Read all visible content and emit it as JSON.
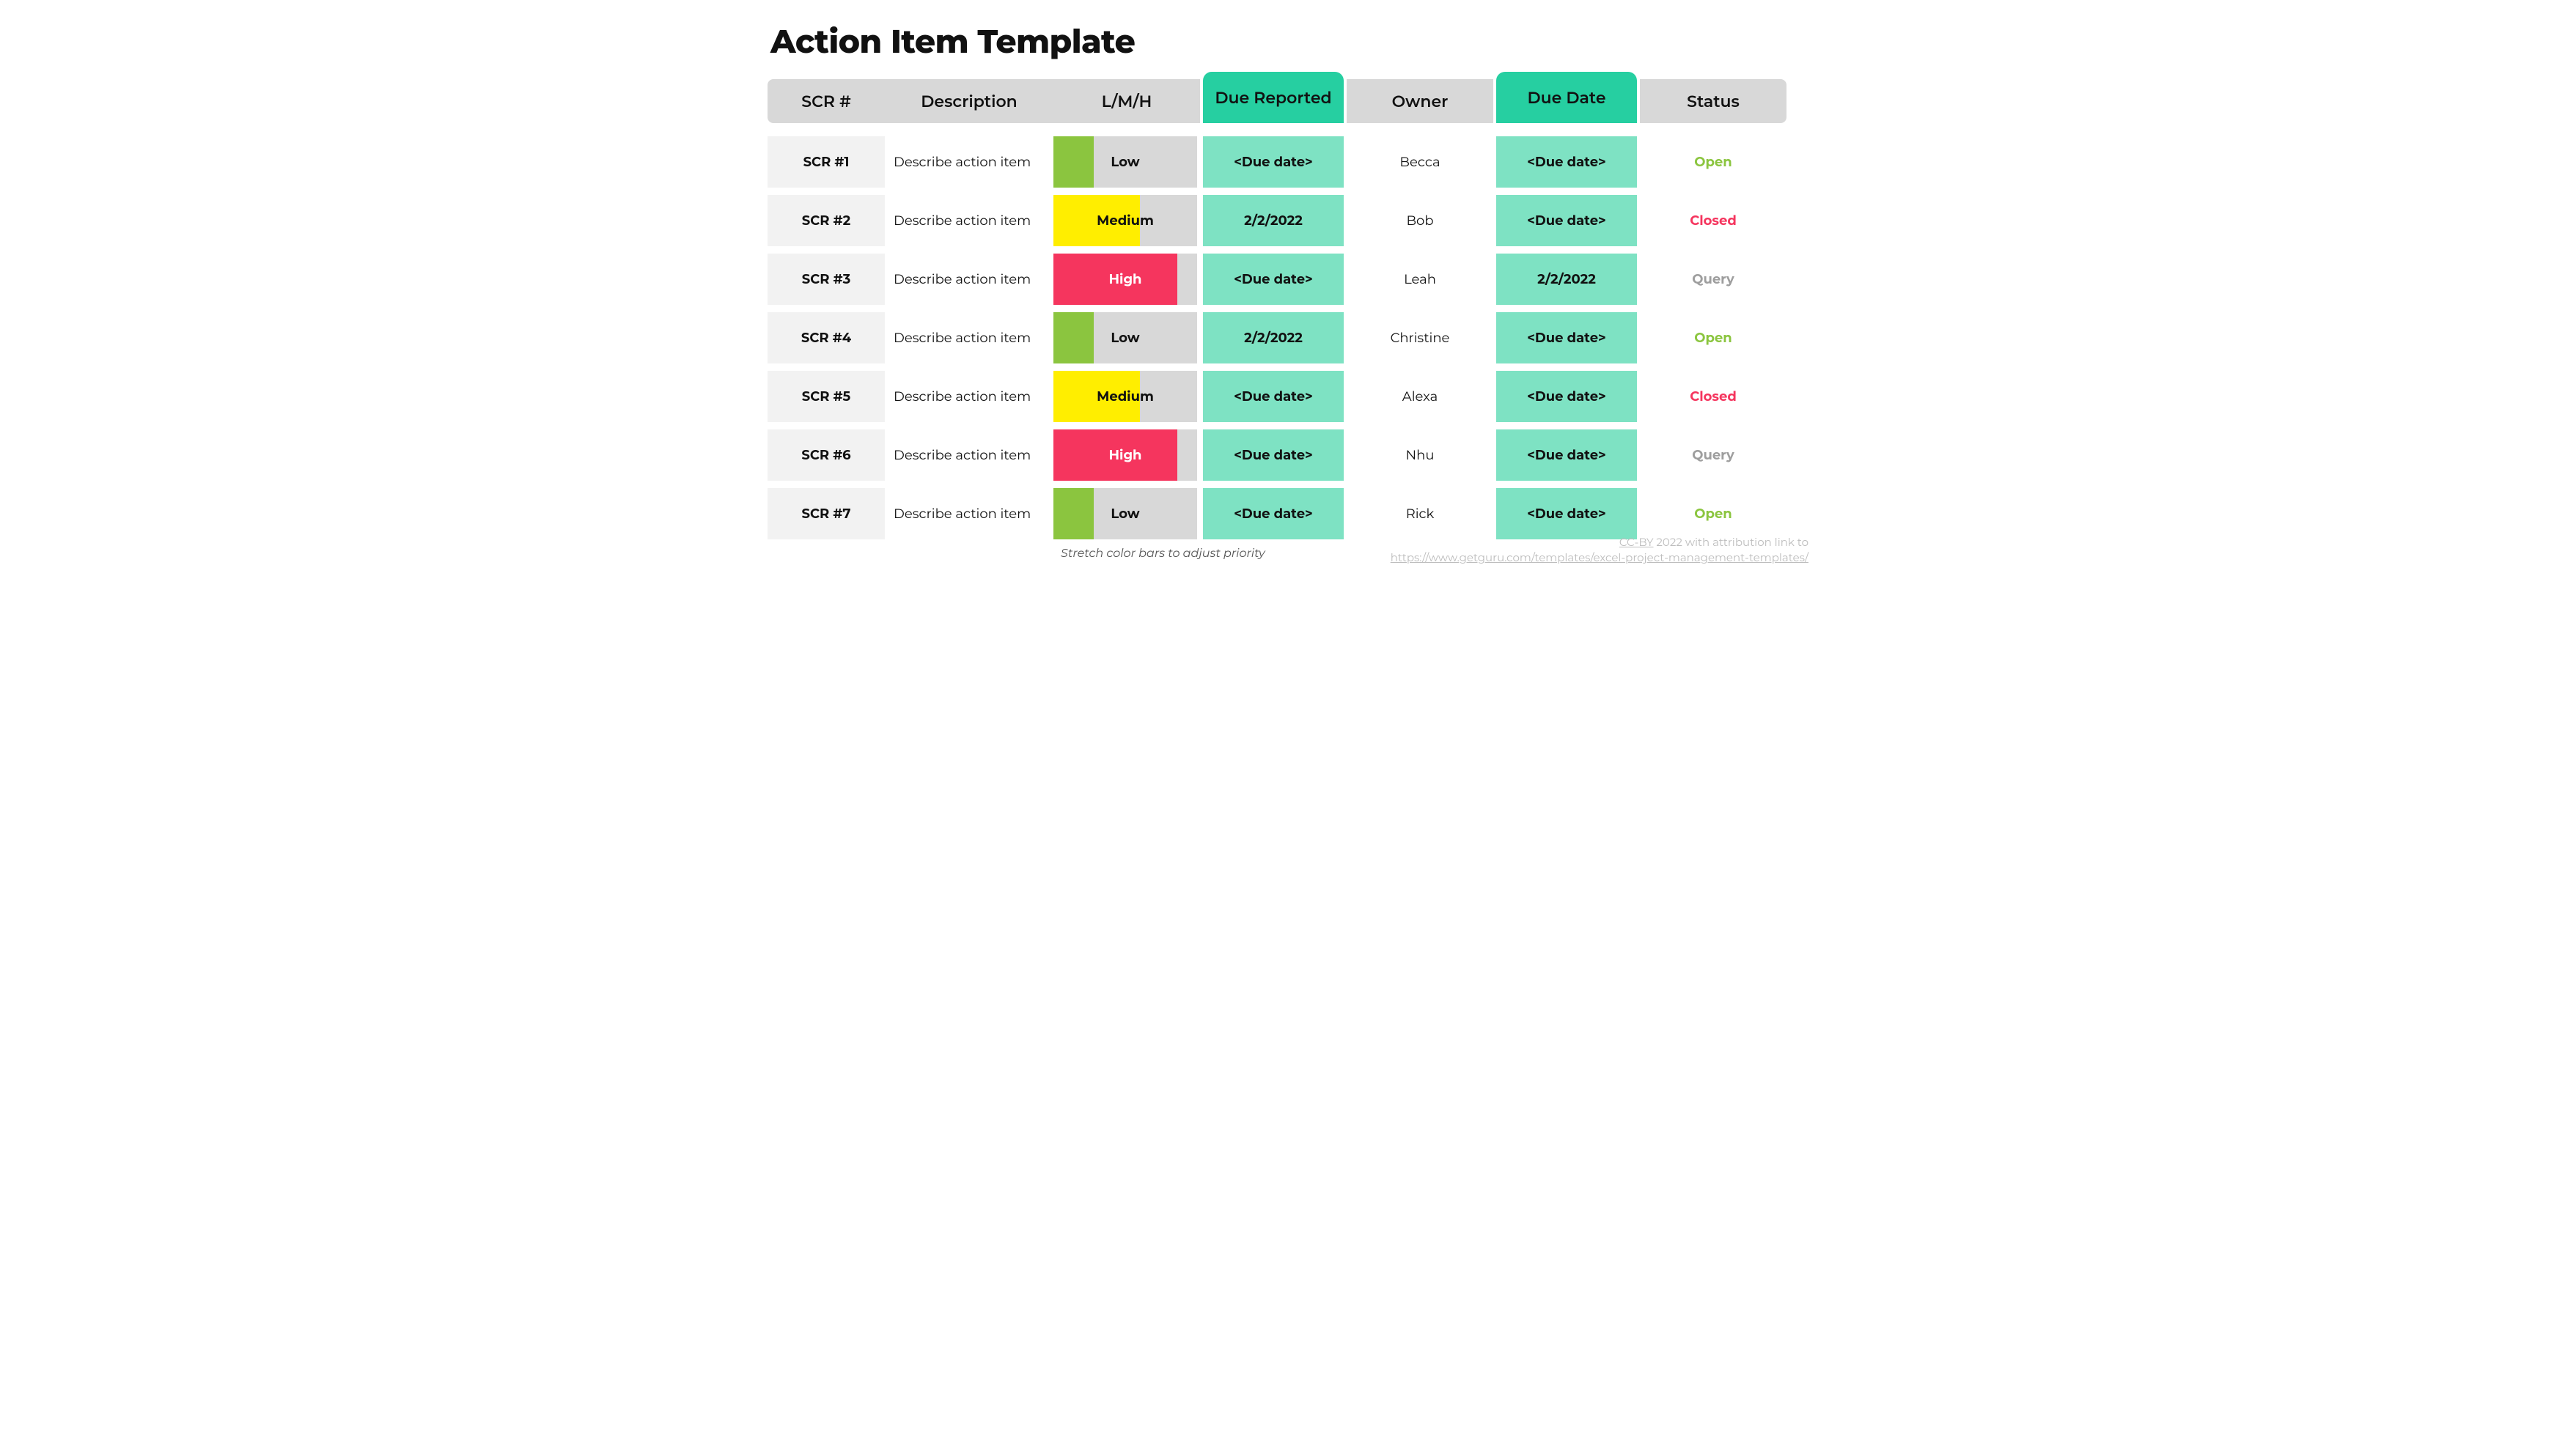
{
  "title": "Action Item Template",
  "headers": {
    "scr": "SCR #",
    "description": "Description",
    "lmh": "L/M/H",
    "due_reported": "Due Reported",
    "owner": "Owner",
    "due_date": "Due Date",
    "status": "Status"
  },
  "rows": [
    {
      "scr": "SCR #1",
      "description": "Describe action item",
      "lmh": "Low",
      "lmh_class": "lmh-low",
      "due_reported": "<Due date>",
      "owner": "Becca",
      "due_date": "<Due date>",
      "status": "Open",
      "status_class": "status-open"
    },
    {
      "scr": "SCR #2",
      "description": "Describe action item",
      "lmh": "Medium",
      "lmh_class": "lmh-medium",
      "due_reported": "2/2/2022",
      "owner": "Bob",
      "due_date": "<Due date>",
      "status": "Closed",
      "status_class": "status-closed"
    },
    {
      "scr": "SCR #3",
      "description": "Describe action item",
      "lmh": "High",
      "lmh_class": "lmh-high",
      "due_reported": "<Due date>",
      "owner": "Leah",
      "due_date": "2/2/2022",
      "status": "Query",
      "status_class": "status-query"
    },
    {
      "scr": "SCR #4",
      "description": "Describe action item",
      "lmh": "Low",
      "lmh_class": "lmh-low",
      "due_reported": "2/2/2022",
      "owner": "Christine",
      "due_date": "<Due date>",
      "status": "Open",
      "status_class": "status-open"
    },
    {
      "scr": "SCR #5",
      "description": "Describe action item",
      "lmh": "Medium",
      "lmh_class": "lmh-medium",
      "due_reported": "<Due date>",
      "owner": "Alexa",
      "due_date": "<Due date>",
      "status": "Closed",
      "status_class": "status-closed"
    },
    {
      "scr": "SCR #6",
      "description": "Describe action item",
      "lmh": "High",
      "lmh_class": "lmh-high",
      "due_reported": "<Due date>",
      "owner": "Nhu",
      "due_date": "<Due date>",
      "status": "Query",
      "status_class": "status-query"
    },
    {
      "scr": "SCR #7",
      "description": "Describe action item",
      "lmh": "Low",
      "lmh_class": "lmh-low",
      "due_reported": "<Due date>",
      "owner": "Rick",
      "due_date": "<Due date>",
      "status": "Open",
      "status_class": "status-open"
    }
  ],
  "footnote": "Stretch color bars to adjust priority",
  "attribution": {
    "line1_prefix": "CC-BY",
    "line1_suffix": " 2022 with attribution link to",
    "line2": "https://www.getguru.com/templates/excel-project-management-templates/"
  }
}
